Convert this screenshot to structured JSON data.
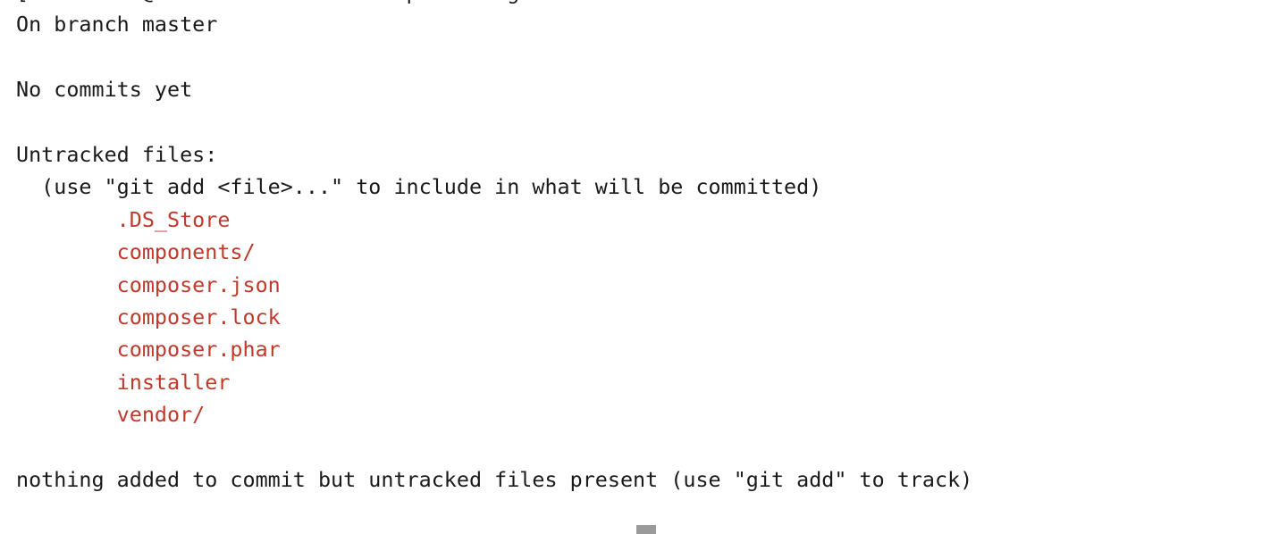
{
  "terminal": {
    "app": "Terminal",
    "shell_prompt": {
      "user": "obenseven",
      "host": "Oben-MacBook-Pro",
      "cwd": "composer",
      "symbol": "%",
      "bracket": "[",
      "full": "[obenseven@Oben-MacBook-Pro composer % git status"
    },
    "command": "git status",
    "colors": {
      "background": "#ffffff",
      "foreground": "#1a1a1a",
      "untracked_red": "#c0392b",
      "cursor": "#9a9a9a"
    },
    "cursor": {
      "shape": "block",
      "visible": true
    },
    "scrollback_clipped_top": true,
    "lines": [
      {
        "id": "prompt-line",
        "segments": [
          {
            "text": "[obenseven@Oben-MacBook-Pro composer % git status",
            "color": "default"
          }
        ]
      },
      {
        "id": "branch-line",
        "segments": [
          {
            "text": "On branch master",
            "color": "default"
          }
        ]
      },
      {
        "id": "blank-1",
        "segments": [
          {
            "text": "",
            "color": "default"
          }
        ]
      },
      {
        "id": "no-commits-line",
        "segments": [
          {
            "text": "No commits yet",
            "color": "default"
          }
        ]
      },
      {
        "id": "blank-2",
        "segments": [
          {
            "text": "",
            "color": "default"
          }
        ]
      },
      {
        "id": "untracked-header",
        "segments": [
          {
            "text": "Untracked files:",
            "color": "default"
          }
        ]
      },
      {
        "id": "untracked-hint",
        "segments": [
          {
            "text": "  (use \"git add <file>...\" to include in what will be committed)",
            "color": "default"
          }
        ]
      },
      {
        "id": "untracked-file-ds-store",
        "segments": [
          {
            "text": "        ",
            "color": "default"
          },
          {
            "text": ".DS_Store",
            "color": "red"
          }
        ]
      },
      {
        "id": "untracked-file-components",
        "segments": [
          {
            "text": "        ",
            "color": "default"
          },
          {
            "text": "components/",
            "color": "red"
          }
        ]
      },
      {
        "id": "untracked-file-composer-json",
        "segments": [
          {
            "text": "        ",
            "color": "default"
          },
          {
            "text": "composer.json",
            "color": "red"
          }
        ]
      },
      {
        "id": "untracked-file-composer-lock",
        "segments": [
          {
            "text": "        ",
            "color": "default"
          },
          {
            "text": "composer.lock",
            "color": "red"
          }
        ]
      },
      {
        "id": "untracked-file-composer-phar",
        "segments": [
          {
            "text": "        ",
            "color": "default"
          },
          {
            "text": "composer.phar",
            "color": "red"
          }
        ]
      },
      {
        "id": "untracked-file-installer",
        "segments": [
          {
            "text": "        ",
            "color": "default"
          },
          {
            "text": "installer",
            "color": "red"
          }
        ]
      },
      {
        "id": "untracked-file-vendor",
        "segments": [
          {
            "text": "        ",
            "color": "default"
          },
          {
            "text": "vendor/",
            "color": "red"
          }
        ]
      },
      {
        "id": "blank-3",
        "segments": [
          {
            "text": "",
            "color": "default"
          }
        ]
      },
      {
        "id": "summary-line",
        "segments": [
          {
            "text": "nothing added to commit but untracked files present (use \"git add\" to track)",
            "color": "default"
          }
        ]
      }
    ],
    "untracked_files": [
      ".DS_Store",
      "components/",
      "composer.json",
      "composer.lock",
      "composer.phar",
      "installer",
      "vendor/"
    ],
    "branch": "master",
    "status_summary": "nothing added to commit but untracked files present (use \"git add\" to track)"
  }
}
